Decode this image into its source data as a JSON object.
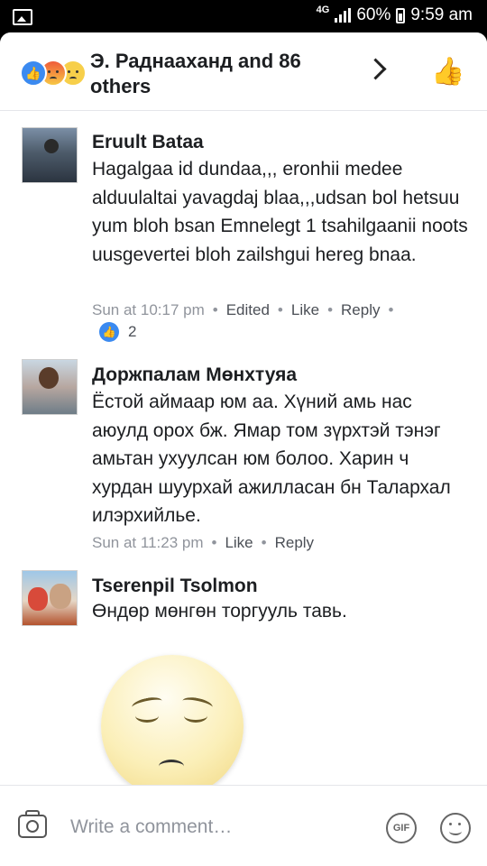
{
  "status_bar": {
    "network": "4G",
    "battery": "60%",
    "time": "9:59 am"
  },
  "header": {
    "title": "Э. Раднааханд and 86 others"
  },
  "comments": [
    {
      "author": "Eruult Bataa",
      "text": "Hagalgaa id dundaa,,, eronhii medee alduulaltai yavagdaj blaa,,,udsan bol hetsuu yum bloh bsan     Emnelegt 1 tsahilgaanii noots uusgevertei bloh zailshgui hereg bnaa.",
      "time": "Sun at 10:17 pm",
      "edited": "Edited",
      "like": "Like",
      "reply": "Reply",
      "likes": "2"
    },
    {
      "author": "Доржпалам Мөнхтуяа",
      "text": "Ёстой аймаар юм аа. Хүний амь нас аюулд орох бж. Ямар том зүрхтэй тэнэг амьтан ухуулсан юм болоо. Харин ч хурдан шуурхай ажилласан бн Талархал илэрхийлье.",
      "time": "Sun at 11:23 pm",
      "like": "Like",
      "reply": "Reply"
    },
    {
      "author": "Tserenpil Tsolmon",
      "text": "Өндөр мөнгөн торгууль тавь."
    }
  ],
  "composer": {
    "placeholder": "Write a comment…",
    "gif": "GIF"
  }
}
